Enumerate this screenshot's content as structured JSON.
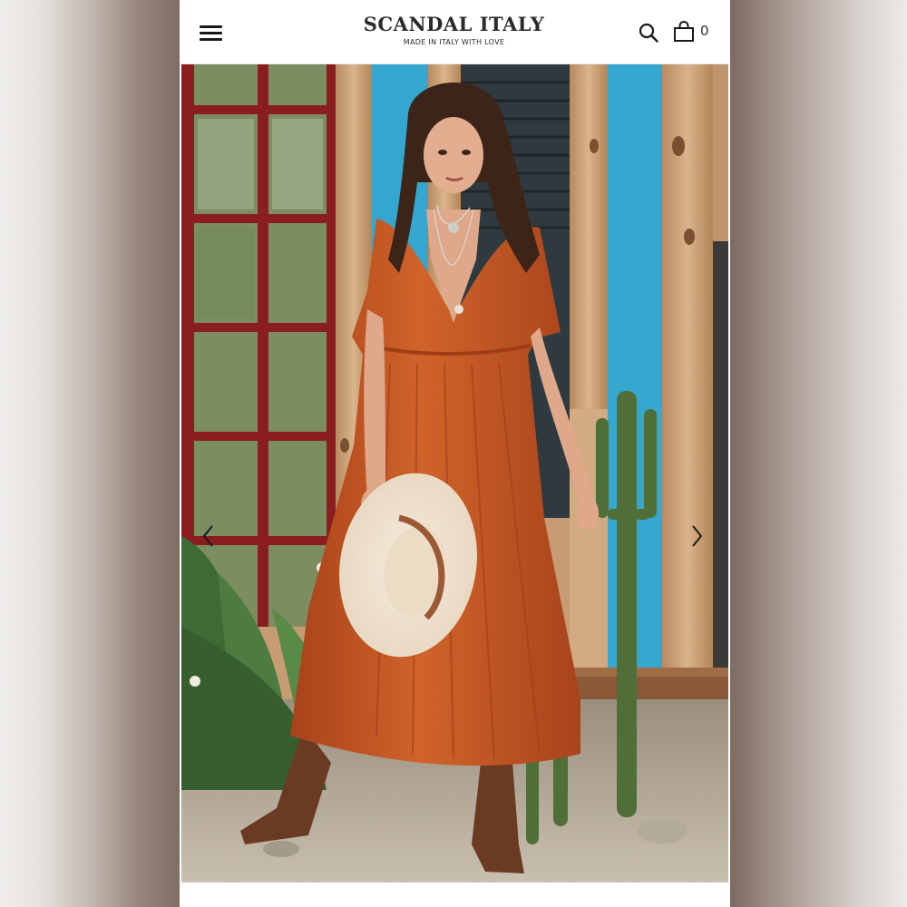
{
  "header": {
    "brand": "SCANDAL ITALY",
    "tagline": "MADE IN ITALY WITH LOVE",
    "cart_count": "0"
  },
  "icons": {
    "menu": "hamburger-menu-icon",
    "search": "search-icon",
    "cart": "shopping-bag-icon",
    "prev": "chevron-left-icon",
    "next": "chevron-right-icon"
  },
  "colors": {
    "dress": "#c2541e",
    "wall_blue": "#2fa3c9",
    "wood": "#caa27c",
    "window_frame": "#8a1e1e"
  }
}
